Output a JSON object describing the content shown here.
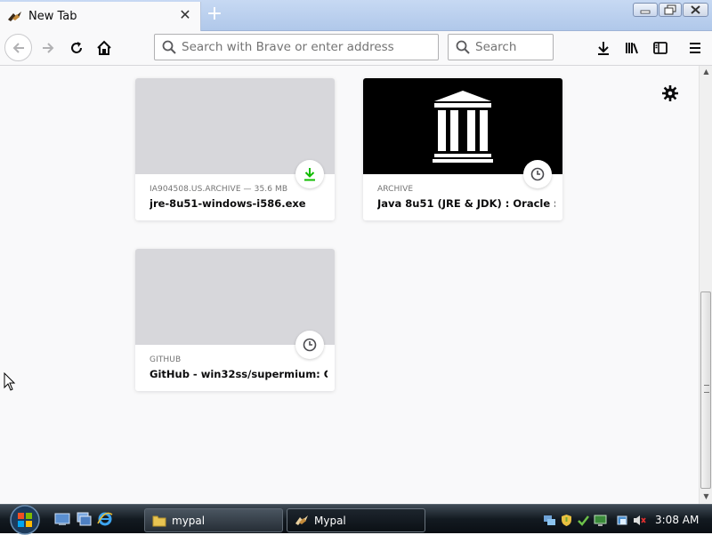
{
  "browser": {
    "tab": {
      "title": "New Tab",
      "close_symbol": "✕"
    },
    "new_tab_symbol": "+",
    "urlbar": {
      "placeholder": "Search with Brave or enter address",
      "value": ""
    },
    "searchbar": {
      "placeholder": "Search",
      "value": ""
    }
  },
  "highlights": {
    "cards": [
      {
        "source": "IA904508.US.ARCHIVE — 35.6 MB",
        "title": "jre-8u51-windows-i586.exe",
        "badge": "download-icon",
        "thumbnail": "blank"
      },
      {
        "source": "ARCHIVE",
        "title": "Java 8u51 (JRE & JDK) : Oracle : ...",
        "badge": "clock-icon",
        "thumbnail": "internet-archive-logo"
      },
      {
        "source": "GITHUB",
        "title": "GitHub - win32ss/supermium: C...",
        "badge": "clock-icon",
        "thumbnail": "blank"
      }
    ]
  },
  "taskbar": {
    "buttons": [
      {
        "label": "mypal",
        "icon": "folder-icon"
      },
      {
        "label": "Mypal",
        "icon": "mypal-icon"
      }
    ],
    "clock": "3:08 AM"
  },
  "colors": {
    "download_badge": "#12bc00",
    "taskbar": "#131a21",
    "titlebar": "#b0c8ea"
  }
}
